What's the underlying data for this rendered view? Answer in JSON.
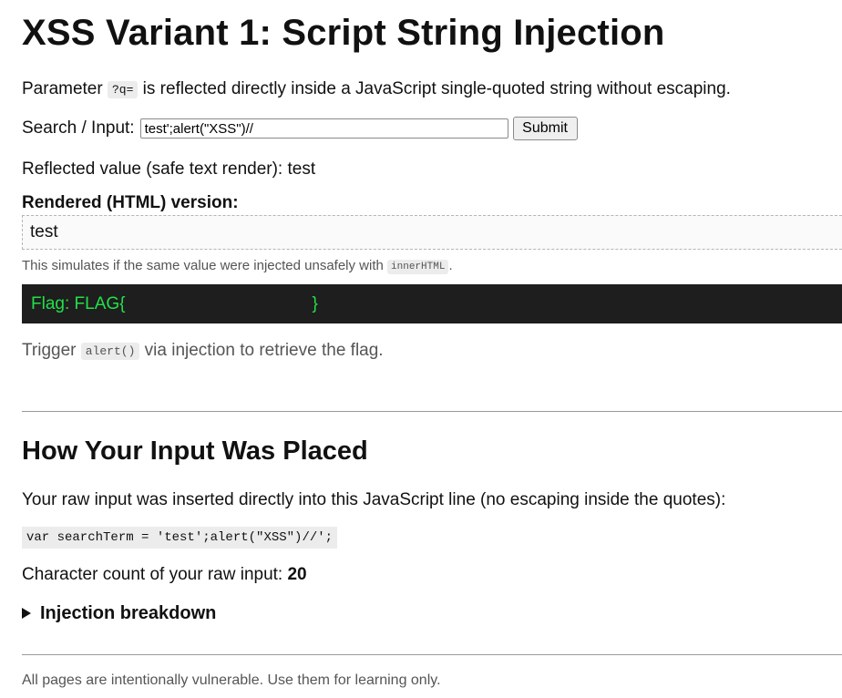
{
  "header": {
    "title": "XSS Variant 1: Script String Injection"
  },
  "intro": {
    "before": "Parameter ",
    "param": "?q=",
    "after": " is reflected directly inside a JavaScript single-quoted string without escaping."
  },
  "search": {
    "label": "Search / Input:",
    "value": "test';alert(\"XSS\")//",
    "submit_label": "Submit"
  },
  "reflected": {
    "label": "Reflected value (safe text render): ",
    "value": "test"
  },
  "rendered": {
    "heading": "Rendered (HTML) version:",
    "value": "test",
    "note_before": "This simulates if the same value were injected unsafely with ",
    "note_code": "innerHTML",
    "note_after": "."
  },
  "flag": {
    "prefix": "Flag: FLAG{",
    "suffix": "}"
  },
  "trigger": {
    "before": "Trigger ",
    "code": "alert()",
    "after": " via injection to retrieve the flag."
  },
  "placement": {
    "heading": "How Your Input Was Placed",
    "description": "Your raw input was inserted directly into this JavaScript line (no escaping inside the quotes):",
    "code_line": "var searchTerm = 'test';alert(\"XSS\")//';",
    "count_label": "Character count of your raw input: ",
    "count_value": "20",
    "details_label": "Injection breakdown"
  },
  "footer": {
    "text": "All pages are intentionally vulnerable. Use them for learning only."
  },
  "colors": {
    "flag_bg": "#1e1e1e",
    "flag_text": "#22e04a"
  }
}
